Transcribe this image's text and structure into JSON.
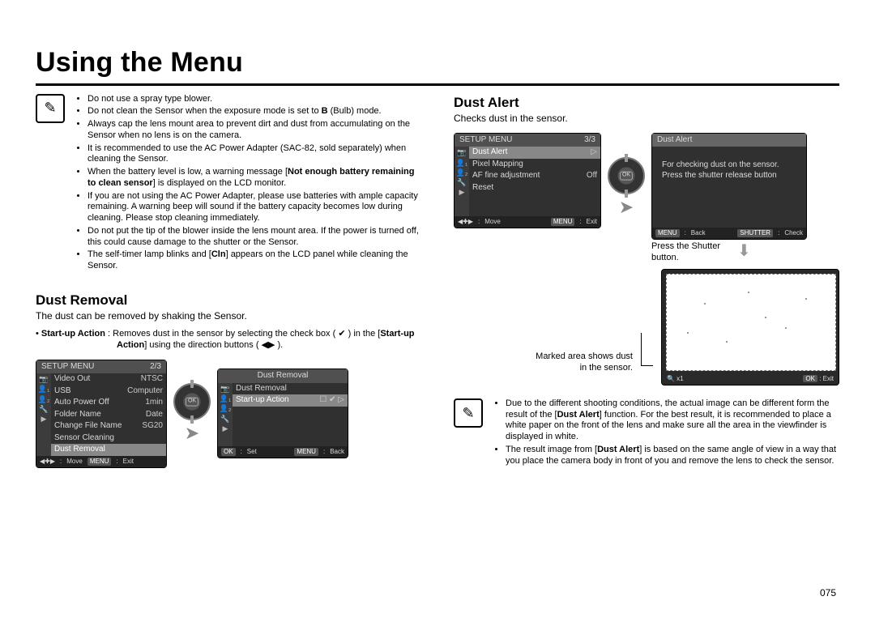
{
  "page_number": "075",
  "main_title": "Using the Menu",
  "left": {
    "note_bullets": [
      "Do not use a spray type blower.",
      "Do not clean the Sensor when the exposure mode is set to <b>B</b> (Bulb) mode.",
      "Always cap the lens mount area to prevent dirt and dust from accumulating on the Sensor when no lens is on the camera.",
      "It is recommended to use the AC Power Adapter (SAC-82, sold separately) when cleaning the Sensor.",
      "When the battery level is low, a warning message [<b>Not enough battery remaining to clean sensor</b>] is displayed on the LCD monitor.",
      "If you are not using the AC Power Adapter, please use batteries with ample capacity remaining. A warning beep will sound if the battery capacity becomes low during cleaning. Please stop cleaning immediately.",
      "Do not put the tip of the blower inside the lens mount area. If the power is turned off, this could cause damage to the shutter or the Sensor.",
      "The self-timer lamp blinks and [<b>Cln</b>] appears on the LCD panel while cleaning the Sensor."
    ],
    "section_title": "Dust Removal",
    "section_sub": "The dust can be removed by shaking the Sensor.",
    "startup_label": "Start-up Action",
    "startup_text": "Removes dust in the sensor by selecting the check box ( ✔ ) in the [<b>Start-up Action</b>] using the direction buttons ( ◀▶ ).",
    "lcd1": {
      "title": "SETUP MENU",
      "page": "2/3",
      "rows": [
        {
          "label": "Video Out",
          "val": "NTSC"
        },
        {
          "label": "USB",
          "val": "Computer"
        },
        {
          "label": "Auto Power Off",
          "val": "1min"
        },
        {
          "label": "Folder Name",
          "val": "Date"
        },
        {
          "label": "Change File Name",
          "val": "SG20"
        },
        {
          "label": "Sensor Cleaning",
          "val": ""
        },
        {
          "label": "Dust Removal",
          "val": "",
          "sel": true
        }
      ],
      "ft_move": "Move",
      "ft_exit": "Exit",
      "ft_menu": "MENU"
    },
    "lcd2": {
      "title": "Dust Removal",
      "rows": [
        {
          "label": "Dust Removal",
          "val": ""
        },
        {
          "label": "Start-up Action",
          "val": "☐ ✔ ▷",
          "sel": true
        }
      ],
      "ft_set": "Set",
      "ft_back": "Back",
      "ft_ok": "OK",
      "ft_menu": "MENU"
    }
  },
  "right": {
    "section_title": "Dust Alert",
    "section_sub": "Checks dust in the sensor.",
    "lcd3": {
      "title": "SETUP MENU",
      "page": "3/3",
      "rows": [
        {
          "label": "Dust Alert",
          "val": "▷",
          "sel": true
        },
        {
          "label": "Pixel Mapping",
          "val": ""
        },
        {
          "label": "AF fine adjustment",
          "val": "Off"
        },
        {
          "label": "Reset",
          "val": ""
        }
      ],
      "ft_move": "Move",
      "ft_exit": "Exit",
      "ft_menu": "MENU"
    },
    "lcd4": {
      "title": "Dust Alert",
      "msg": "For checking dust on the sensor. Press the shutter release button",
      "ft_back": "Back",
      "ft_check": "Check",
      "ft_menu": "MENU",
      "ft_shutter": "SHUTTER"
    },
    "press_caption": "Press the Shutter button.",
    "marked_caption": "Marked area shows dust in the sensor.",
    "preview_ft": {
      "zoom": "🔍  x1",
      "exit": "Exit",
      "ok": "OK"
    },
    "note_bullets": [
      "Due to the different shooting conditions, the actual image can be different form the result of the [<b>Dust Alert</b>] function. For the best result, it is recommended to place a white paper on the front of the lens and make sure all the area in the viewfinder is displayed in white.",
      "The result image from [<b>Dust Alert</b>] is based on the same angle of view in a way that you place the camera body in front of you and remove the lens to check the sensor."
    ]
  },
  "icons": {
    "camera": "📷",
    "user1": "👤₁",
    "user2": "👤₂",
    "tool": "🔧",
    "play": "▶"
  }
}
